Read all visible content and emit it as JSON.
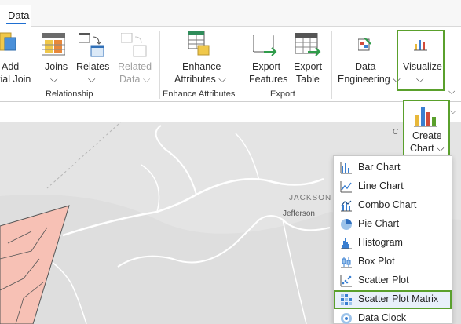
{
  "tabs": {
    "active": "Data"
  },
  "ribbon": {
    "buttons": {
      "add_spatial_join": {
        "line1": "Add",
        "line2": "tial Join"
      },
      "joins": {
        "line1": "Joins",
        "line2": "⌵"
      },
      "relates": {
        "line1": "Relates",
        "line2": "⌵"
      },
      "related_data": {
        "line1": "Related",
        "line2": "Data ⌵"
      },
      "enhance_attributes": {
        "line1": "Enhance",
        "line2": "Attributes ⌵"
      },
      "export_features": {
        "line1": "Export",
        "line2": "Features"
      },
      "export_table": {
        "line1": "Export",
        "line2": "Table"
      },
      "data_engineering": {
        "line1": "Data",
        "line2": "Engineering ⌵"
      },
      "visualize": {
        "line1": "Visualize",
        "line2": "⌵"
      }
    },
    "groups": {
      "relationship": "Relationship",
      "enhance_attributes": "Enhance Attributes",
      "export": "Export"
    }
  },
  "create_chart": {
    "line1": "Create",
    "line2": "Chart ⌵"
  },
  "map": {
    "labels": {
      "jackson": "JACKSON",
      "jefferson": "Jefferson",
      "edge_letter": "C"
    }
  },
  "chart_menu": {
    "items": [
      {
        "label": "Bar Chart",
        "icon": "bar-chart-icon"
      },
      {
        "label": "Line Chart",
        "icon": "line-chart-icon"
      },
      {
        "label": "Combo Chart",
        "icon": "combo-chart-icon"
      },
      {
        "label": "Pie Chart",
        "icon": "pie-chart-icon"
      },
      {
        "label": "Histogram",
        "icon": "histogram-icon"
      },
      {
        "label": "Box Plot",
        "icon": "box-plot-icon"
      },
      {
        "label": "Scatter Plot",
        "icon": "scatter-plot-icon"
      },
      {
        "label": "Scatter Plot Matrix",
        "icon": "scatter-plot-matrix-icon",
        "highlighted": true
      },
      {
        "label": "Data Clock",
        "icon": "data-clock-icon"
      }
    ]
  },
  "colors": {
    "accent": "#1f6fd1",
    "highlight": "#5aa02c",
    "polygon": "#f7c1b5"
  }
}
